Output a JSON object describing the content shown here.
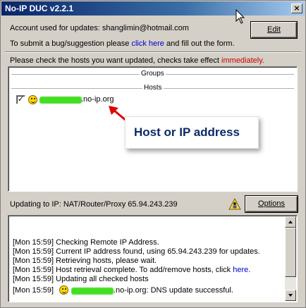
{
  "window": {
    "title": "No-IP DUC v2.2.1",
    "close_glyph": "×"
  },
  "account": {
    "label": "Account used for updates:",
    "email": "shanglimin@hotmail.com",
    "edit_label": "Edit",
    "bug_prefix": "To submit a bug/suggestion please",
    "bug_link": "click here",
    "bug_suffix": "and fill out the form."
  },
  "hosts": {
    "instructions": "Please check the hosts you want updated, checks take effect",
    "instructions_emphasis": "immediately.",
    "groups_label": "Groups",
    "hosts_label": "Hosts",
    "host_checked": true,
    "host_domain_suffix": ".no-ip.org",
    "callout_text": "Host or IP address",
    "redaction_color": "#44dd22",
    "arrow_color": "#e00000"
  },
  "status": {
    "updating_label": "Updating to IP: NAT/Router/Proxy 65.94.243.239",
    "options_label": "Options"
  },
  "log": {
    "lines": [
      "[Mon 15:59]  Checking Remote IP Address.",
      "[Mon 15:59]  Current IP address found, using 65.94.243.239 for updates.",
      "[Mon 15:59]  Retrieving hosts, please wait.",
      "[Mon 15:59]  Host retrieval complete. To add/remove hosts, click",
      "[Mon 15:59]  Updating all checked hosts",
      "[Mon 15:59]"
    ],
    "line4_link": "here.",
    "line6_suffix": ".no-ip.org: DNS update successful."
  },
  "icons": [
    "close-icon",
    "cursor-arrow-icon",
    "smiley-icon",
    "person-icon",
    "scroll-up-icon",
    "scroll-down-icon"
  ]
}
